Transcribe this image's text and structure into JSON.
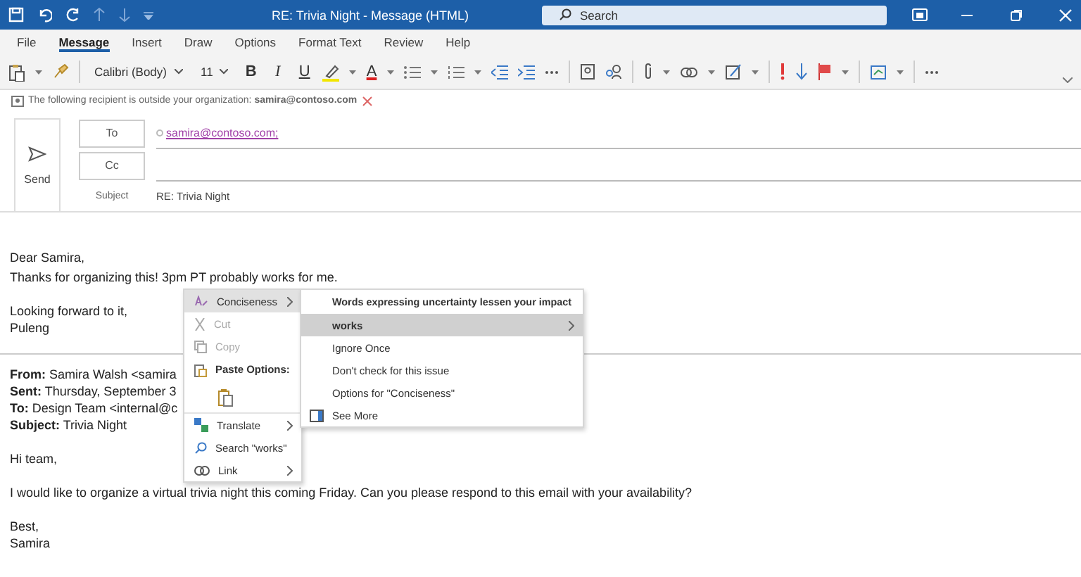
{
  "window": {
    "title": "RE: Trivia Night  -  Message (HTML)"
  },
  "search": {
    "placeholder": "Search"
  },
  "tabs": [
    {
      "label": "File",
      "selected": false
    },
    {
      "label": "Message",
      "selected": true
    },
    {
      "label": "Insert",
      "selected": false
    },
    {
      "label": "Draw",
      "selected": false
    },
    {
      "label": "Options",
      "selected": false
    },
    {
      "label": "Format Text",
      "selected": false
    },
    {
      "label": "Review",
      "selected": false
    },
    {
      "label": "Help",
      "selected": false
    }
  ],
  "ribbon": {
    "font": "Calibri (Body)",
    "size": "11",
    "format_buttons": [
      {
        "label": "B"
      },
      {
        "label": "I"
      },
      {
        "label": "U"
      }
    ],
    "font_color_button": "A"
  },
  "notice": {
    "text": "The following recipient is outside your organization: **samira@contoso.com**"
  },
  "compose": {
    "send": "Send",
    "to_button": "To",
    "cc_button": "Cc",
    "to_value": "samira@contoso.com;",
    "subject_label": "Subject",
    "subject_value": "RE: Trivia Night"
  },
  "body": {
    "paragraphs": [
      [
        "Dear Samira,"
      ],
      [
        "Thanks for organizing this! 3pm PT probably works for me."
      ],
      [
        "Looking forward to it,",
        "Puleng"
      ]
    ],
    "quoted_header": [
      "**From:** Samira Walsh <samira",
      "**Sent:** Thursday, September 3",
      "**To:** Design Team <internal@c",
      "**Subject:** Trivia Night"
    ],
    "quoted_paragraphs": [
      [
        "Hi team,"
      ],
      [
        "I would like to organize a virtual trivia night this coming Friday. Can you please respond to this email with your availability?"
      ],
      [
        "Best,",
        "Samira"
      ]
    ]
  },
  "context_menu": {
    "items": [
      {
        "kind": "item",
        "label": "Conciseness",
        "selected": true,
        "disabled": false,
        "submenu": true
      },
      {
        "kind": "item",
        "label": "Cut",
        "selected": false,
        "disabled": true,
        "submenu": false
      },
      {
        "kind": "item",
        "label": "Copy",
        "selected": false,
        "disabled": true,
        "submenu": false
      },
      {
        "kind": "heading",
        "label": "Paste Options:"
      },
      {
        "kind": "paste-icon"
      },
      {
        "kind": "item",
        "label": "Translate",
        "selected": false,
        "disabled": false,
        "submenu": true
      },
      {
        "kind": "item",
        "label": "Search \"works\"",
        "selected": false,
        "disabled": false,
        "submenu": false
      },
      {
        "kind": "item",
        "label": "Link",
        "selected": false,
        "disabled": false,
        "submenu": true
      }
    ]
  },
  "submenu": {
    "items": [
      {
        "kind": "heading",
        "label": "Words expressing uncertainty lessen your impact"
      },
      {
        "kind": "item",
        "label": "works",
        "selected": true,
        "submenu": true
      },
      {
        "kind": "item",
        "label": "Ignore Once",
        "selected": false,
        "submenu": false
      },
      {
        "kind": "item",
        "label": "Don't check for this issue",
        "selected": false,
        "submenu": false
      },
      {
        "kind": "item",
        "label": "Options for \"Conciseness\"",
        "selected": false,
        "submenu": false
      },
      {
        "kind": "item",
        "label": "See More",
        "selected": false,
        "submenu": false
      }
    ]
  }
}
